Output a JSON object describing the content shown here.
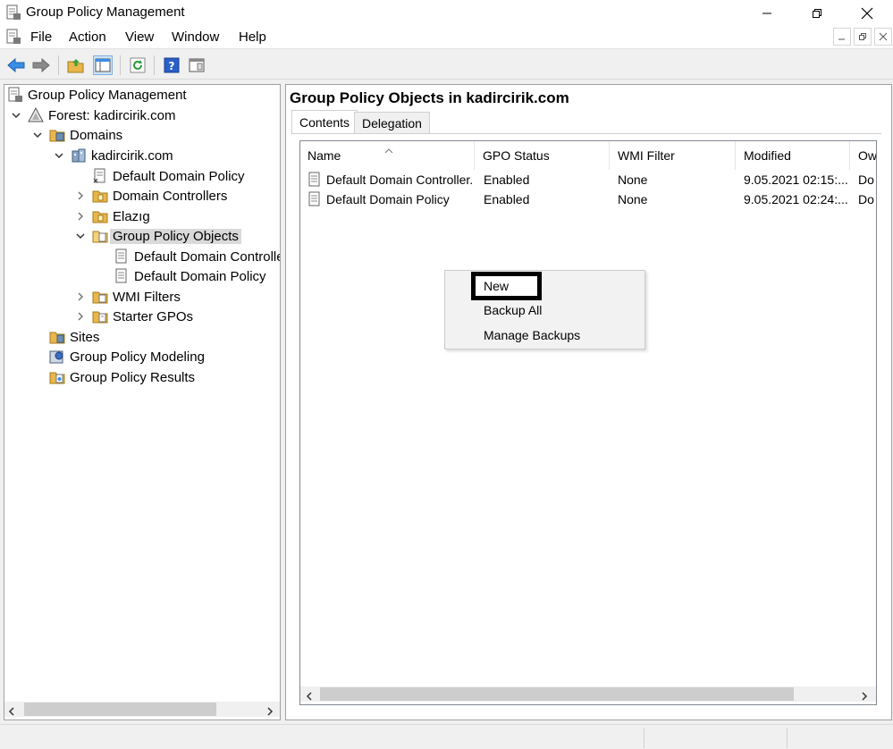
{
  "window": {
    "title": "Group Policy Management",
    "icon": "gpmc-icon"
  },
  "menu": [
    "File",
    "Action",
    "View",
    "Window",
    "Help"
  ],
  "tree": {
    "items": [
      {
        "label": "Group Policy Management",
        "icon": "gpmc-icon"
      },
      {
        "label": "Forest: kadircirik.com",
        "icon": "forest-icon"
      },
      {
        "label": "Domains",
        "icon": "domains-folder-icon"
      },
      {
        "label": "kadircirik.com",
        "icon": "domain-icon"
      },
      {
        "label": "Default Domain Policy",
        "icon": "gpo-link-icon"
      },
      {
        "label": "Domain Controllers",
        "icon": "ou-folder-icon"
      },
      {
        "label": "Elazıg",
        "icon": "ou-folder-icon"
      },
      {
        "label": "Group Policy Objects",
        "icon": "gpo-folder-icon"
      },
      {
        "label": "Default Domain Controllers Policy",
        "icon": "gpo-icon"
      },
      {
        "label": "Default Domain Policy",
        "icon": "gpo-icon"
      },
      {
        "label": "WMI Filters",
        "icon": "wmi-folder-icon"
      },
      {
        "label": "Starter GPOs",
        "icon": "starter-folder-icon"
      },
      {
        "label": "Sites",
        "icon": "sites-icon"
      },
      {
        "label": "Group Policy Modeling",
        "icon": "modeling-icon"
      },
      {
        "label": "Group Policy Results",
        "icon": "results-icon"
      }
    ]
  },
  "right": {
    "heading": "Group Policy Objects in kadircirik.com",
    "tabs": [
      "Contents",
      "Delegation"
    ],
    "columns": [
      "Name",
      "GPO Status",
      "WMI Filter",
      "Modified",
      "Ow"
    ],
    "rows": [
      {
        "name": "Default Domain Controller...",
        "status": "Enabled",
        "wmi": "None",
        "modified": "9.05.2021 02:15:...",
        "owner": "Do"
      },
      {
        "name": "Default Domain Policy",
        "status": "Enabled",
        "wmi": "None",
        "modified": "9.05.2021 02:24:...",
        "owner": "Do"
      }
    ]
  },
  "context_menu": [
    "New",
    "Backup All",
    "Manage Backups"
  ],
  "colors": {
    "folder": "#e8b64a",
    "selection": "#d9d9d9",
    "arrow_blue": "#3a8ee6"
  }
}
